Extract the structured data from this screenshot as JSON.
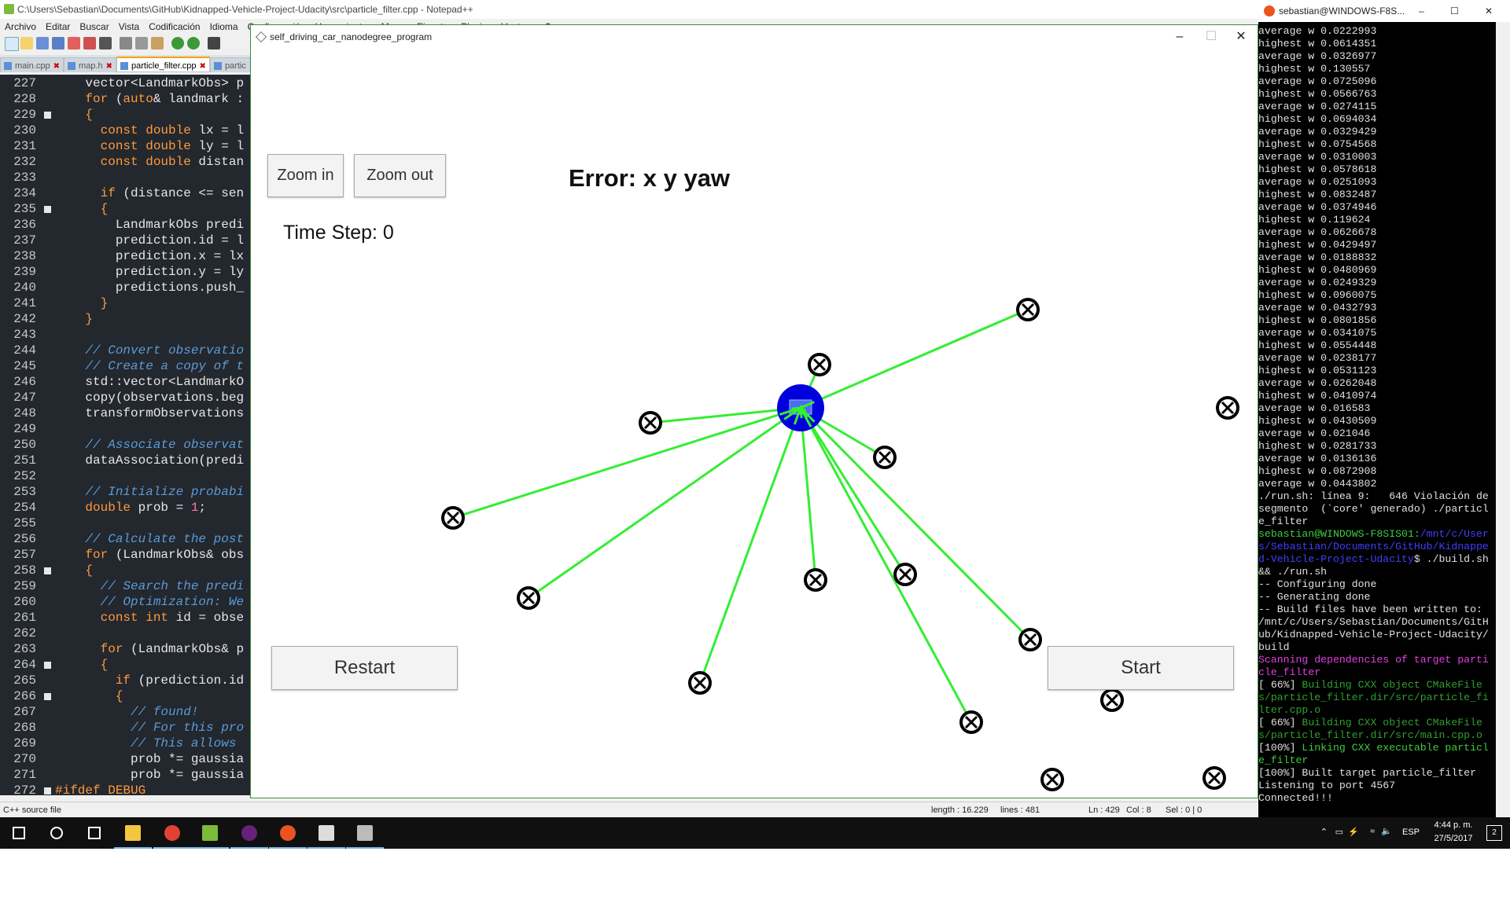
{
  "npp": {
    "title": "C:\\Users\\Sebastian\\Documents\\GitHub\\Kidnapped-Vehicle-Project-Udacity\\src\\particle_filter.cpp - Notepad++",
    "menu": [
      "Archivo",
      "Editar",
      "Buscar",
      "Vista",
      "Codificación",
      "Idioma",
      "Configuración",
      "Herramientas",
      "Macro",
      "Ejecutar",
      "Plugins",
      "Ventana",
      "?"
    ],
    "tabs": [
      {
        "label": "main.cpp",
        "active": false
      },
      {
        "label": "map.h",
        "active": false
      },
      {
        "label": "particle_filter.cpp",
        "active": true
      },
      {
        "label": "partic",
        "active": false
      }
    ],
    "code_lines": [
      {
        "n": "227",
        "fold": false,
        "segs": [
          {
            "t": "    vector<LandmarkObs> p",
            "c": ""
          }
        ]
      },
      {
        "n": "228",
        "fold": false,
        "segs": [
          {
            "t": "    ",
            "c": ""
          },
          {
            "t": "for",
            "c": "kw"
          },
          {
            "t": " (",
            "c": ""
          },
          {
            "t": "auto",
            "c": "kw"
          },
          {
            "t": "& landmark :",
            "c": ""
          }
        ]
      },
      {
        "n": "229",
        "fold": true,
        "segs": [
          {
            "t": "    {",
            "c": "kw"
          }
        ]
      },
      {
        "n": "230",
        "fold": false,
        "segs": [
          {
            "t": "      ",
            "c": ""
          },
          {
            "t": "const double",
            "c": "kw"
          },
          {
            "t": " lx = l",
            "c": ""
          }
        ]
      },
      {
        "n": "231",
        "fold": false,
        "segs": [
          {
            "t": "      ",
            "c": ""
          },
          {
            "t": "const double",
            "c": "kw"
          },
          {
            "t": " ly = l",
            "c": ""
          }
        ]
      },
      {
        "n": "232",
        "fold": false,
        "segs": [
          {
            "t": "      ",
            "c": ""
          },
          {
            "t": "const double",
            "c": "kw"
          },
          {
            "t": " distan",
            "c": ""
          }
        ]
      },
      {
        "n": "233",
        "fold": false,
        "segs": [
          {
            "t": "",
            "c": ""
          }
        ]
      },
      {
        "n": "234",
        "fold": false,
        "segs": [
          {
            "t": "      ",
            "c": ""
          },
          {
            "t": "if",
            "c": "kw"
          },
          {
            "t": " (distance <= sen",
            "c": ""
          }
        ]
      },
      {
        "n": "235",
        "fold": true,
        "segs": [
          {
            "t": "      {",
            "c": "kw"
          }
        ]
      },
      {
        "n": "236",
        "fold": false,
        "segs": [
          {
            "t": "        LandmarkObs predi",
            "c": ""
          }
        ]
      },
      {
        "n": "237",
        "fold": false,
        "segs": [
          {
            "t": "        prediction.id = l",
            "c": ""
          }
        ]
      },
      {
        "n": "238",
        "fold": false,
        "segs": [
          {
            "t": "        prediction.x = lx",
            "c": ""
          }
        ]
      },
      {
        "n": "239",
        "fold": false,
        "segs": [
          {
            "t": "        prediction.y = ly",
            "c": ""
          }
        ]
      },
      {
        "n": "240",
        "fold": false,
        "segs": [
          {
            "t": "        predictions.push_",
            "c": ""
          }
        ]
      },
      {
        "n": "241",
        "fold": false,
        "segs": [
          {
            "t": "      }",
            "c": "kw"
          }
        ]
      },
      {
        "n": "242",
        "fold": false,
        "segs": [
          {
            "t": "    }",
            "c": "kw"
          }
        ]
      },
      {
        "n": "243",
        "fold": false,
        "segs": [
          {
            "t": "",
            "c": ""
          }
        ]
      },
      {
        "n": "244",
        "fold": false,
        "segs": [
          {
            "t": "    // Convert observatio",
            "c": "cm"
          }
        ]
      },
      {
        "n": "245",
        "fold": false,
        "segs": [
          {
            "t": "    // Create a copy of t",
            "c": "cm"
          }
        ]
      },
      {
        "n": "246",
        "fold": false,
        "segs": [
          {
            "t": "    std::vector<LandmarkO",
            "c": ""
          }
        ]
      },
      {
        "n": "247",
        "fold": false,
        "segs": [
          {
            "t": "    copy(observations.beg",
            "c": ""
          }
        ]
      },
      {
        "n": "248",
        "fold": false,
        "segs": [
          {
            "t": "    transformObservations",
            "c": ""
          }
        ]
      },
      {
        "n": "249",
        "fold": false,
        "segs": [
          {
            "t": "",
            "c": ""
          }
        ]
      },
      {
        "n": "250",
        "fold": false,
        "segs": [
          {
            "t": "    // Associate observat",
            "c": "cm"
          }
        ]
      },
      {
        "n": "251",
        "fold": false,
        "segs": [
          {
            "t": "    dataAssociation(predi",
            "c": ""
          }
        ]
      },
      {
        "n": "252",
        "fold": false,
        "segs": [
          {
            "t": "",
            "c": ""
          }
        ]
      },
      {
        "n": "253",
        "fold": false,
        "segs": [
          {
            "t": "    // Initialize probabi",
            "c": "cm"
          }
        ]
      },
      {
        "n": "254",
        "fold": false,
        "segs": [
          {
            "t": "    ",
            "c": ""
          },
          {
            "t": "double",
            "c": "kw"
          },
          {
            "t": " prob = ",
            "c": ""
          },
          {
            "t": "1",
            "c": "num"
          },
          {
            "t": ";",
            "c": ""
          }
        ]
      },
      {
        "n": "255",
        "fold": false,
        "segs": [
          {
            "t": "",
            "c": ""
          }
        ]
      },
      {
        "n": "256",
        "fold": false,
        "segs": [
          {
            "t": "    // Calculate the post",
            "c": "cm"
          }
        ]
      },
      {
        "n": "257",
        "fold": false,
        "segs": [
          {
            "t": "    ",
            "c": ""
          },
          {
            "t": "for",
            "c": "kw"
          },
          {
            "t": " (LandmarkObs& obs",
            "c": ""
          }
        ]
      },
      {
        "n": "258",
        "fold": true,
        "segs": [
          {
            "t": "    {",
            "c": "kw"
          }
        ]
      },
      {
        "n": "259",
        "fold": false,
        "segs": [
          {
            "t": "      // Search the predi",
            "c": "cm"
          }
        ]
      },
      {
        "n": "260",
        "fold": false,
        "segs": [
          {
            "t": "      // Optimization: We",
            "c": "cm"
          }
        ]
      },
      {
        "n": "261",
        "fold": false,
        "segs": [
          {
            "t": "      ",
            "c": ""
          },
          {
            "t": "const int",
            "c": "kw"
          },
          {
            "t": " id = obse",
            "c": ""
          }
        ]
      },
      {
        "n": "262",
        "fold": false,
        "segs": [
          {
            "t": "",
            "c": ""
          }
        ]
      },
      {
        "n": "263",
        "fold": false,
        "segs": [
          {
            "t": "      ",
            "c": ""
          },
          {
            "t": "for",
            "c": "kw"
          },
          {
            "t": " (LandmarkObs& p",
            "c": ""
          }
        ]
      },
      {
        "n": "264",
        "fold": true,
        "segs": [
          {
            "t": "      {",
            "c": "kw"
          }
        ]
      },
      {
        "n": "265",
        "fold": false,
        "segs": [
          {
            "t": "        ",
            "c": ""
          },
          {
            "t": "if",
            "c": "kw"
          },
          {
            "t": " (prediction.id",
            "c": ""
          }
        ]
      },
      {
        "n": "266",
        "fold": true,
        "segs": [
          {
            "t": "        {",
            "c": "kw"
          }
        ]
      },
      {
        "n": "267",
        "fold": false,
        "segs": [
          {
            "t": "          // found!",
            "c": "cm"
          }
        ]
      },
      {
        "n": "268",
        "fold": false,
        "segs": [
          {
            "t": "          // For this pro",
            "c": "cm"
          }
        ]
      },
      {
        "n": "269",
        "fold": false,
        "segs": [
          {
            "t": "          // This allows ",
            "c": "cm"
          }
        ]
      },
      {
        "n": "270",
        "fold": false,
        "segs": [
          {
            "t": "          prob *= gaussia",
            "c": ""
          }
        ]
      },
      {
        "n": "271",
        "fold": false,
        "segs": [
          {
            "t": "          prob *= gaussia",
            "c": ""
          }
        ]
      },
      {
        "n": "272",
        "fold": true,
        "segs": [
          {
            "t": "#ifdef DEBUG",
            "c": "kw"
          }
        ]
      }
    ],
    "status": {
      "file_type": "C++ source file",
      "length": "length : 16.229",
      "lines": "lines : 481",
      "ln": "Ln : 429",
      "col": "Col : 8",
      "sel": "Sel : 0 | 0"
    }
  },
  "sim": {
    "title": "self_driving_car_nanodegree_program",
    "zoom_in": "Zoom in",
    "zoom_out": "Zoom out",
    "error": "Error: x y yaw",
    "time_step": "Time Step: 0",
    "restart": "Restart",
    "start": "Start"
  },
  "terminal": {
    "title": "sebastian@WINDOWS-F8S...",
    "lines": [
      {
        "t": "average w 0.0222993",
        "c": ""
      },
      {
        "t": "highest w 0.0614351",
        "c": ""
      },
      {
        "t": "average w 0.0326977",
        "c": ""
      },
      {
        "t": "highest w 0.130557",
        "c": ""
      },
      {
        "t": "average w 0.0725096",
        "c": ""
      },
      {
        "t": "highest w 0.0566763",
        "c": ""
      },
      {
        "t": "average w 0.0274115",
        "c": ""
      },
      {
        "t": "highest w 0.0694034",
        "c": ""
      },
      {
        "t": "average w 0.0329429",
        "c": ""
      },
      {
        "t": "highest w 0.0754568",
        "c": ""
      },
      {
        "t": "average w 0.0310003",
        "c": ""
      },
      {
        "t": "highest w 0.0578618",
        "c": ""
      },
      {
        "t": "average w 0.0251093",
        "c": ""
      },
      {
        "t": "highest w 0.0832487",
        "c": ""
      },
      {
        "t": "average w 0.0374946",
        "c": ""
      },
      {
        "t": "highest w 0.119624",
        "c": ""
      },
      {
        "t": "average w 0.0626678",
        "c": ""
      },
      {
        "t": "highest w 0.0429497",
        "c": ""
      },
      {
        "t": "average w 0.0188832",
        "c": ""
      },
      {
        "t": "highest w 0.0480969",
        "c": ""
      },
      {
        "t": "average w 0.0249329",
        "c": ""
      },
      {
        "t": "highest w 0.0960075",
        "c": ""
      },
      {
        "t": "average w 0.0432793",
        "c": ""
      },
      {
        "t": "highest w 0.0801856",
        "c": ""
      },
      {
        "t": "average w 0.0341075",
        "c": ""
      },
      {
        "t": "highest w 0.0554448",
        "c": ""
      },
      {
        "t": "average w 0.0238177",
        "c": ""
      },
      {
        "t": "highest w 0.0531123",
        "c": ""
      },
      {
        "t": "average w 0.0262048",
        "c": ""
      },
      {
        "t": "highest w 0.0410974",
        "c": ""
      },
      {
        "t": "average w 0.016583",
        "c": ""
      },
      {
        "t": "highest w 0.0430509",
        "c": ""
      },
      {
        "t": "average w 0.021046",
        "c": ""
      },
      {
        "t": "highest w 0.0281733",
        "c": ""
      },
      {
        "t": "average w 0.0136136",
        "c": ""
      },
      {
        "t": "highest w 0.0872908",
        "c": ""
      },
      {
        "t": "average w 0.0443802",
        "c": ""
      },
      {
        "t": "./run.sh: línea 9:   646 Violación de segmento  (`core' generado) ./particle_filter",
        "c": ""
      },
      {
        "t": "sebastian@WINDOWS-F8SIS01:",
        "c": "tg",
        "x": [
          {
            "t": "/mnt/c/Users/Sebastian/Documents/GitHub/Kidnapped-Vehicle-Project-Udacity",
            "c": "tbl"
          },
          {
            "t": "$ ./build.sh && ./run.sh",
            "c": ""
          }
        ]
      },
      {
        "t": "-- Configuring done",
        "c": ""
      },
      {
        "t": "-- Generating done",
        "c": ""
      },
      {
        "t": "-- Build files have been written to: /mnt/c/Users/Sebastian/Documents/GitHub/Kidnapped-Vehicle-Project-Udacity/build",
        "c": ""
      },
      {
        "t": "Scanning dependencies of target particle_filter",
        "c": "tm"
      },
      {
        "t": "[ 66%] ",
        "c": "",
        "x": [
          {
            "t": "Building CXX object CMakeFiles/particle_filter.dir/src/particle_filter.cpp.o",
            "c": "tdg"
          }
        ]
      },
      {
        "t": "[ 66%] ",
        "c": "",
        "x": [
          {
            "t": "Building CXX object CMakeFiles/particle_filter.dir/src/main.cpp.o",
            "c": "tdg"
          }
        ]
      },
      {
        "t": "[100%] ",
        "c": "",
        "x": [
          {
            "t": "Linking CXX executable particle_filter",
            "c": "tg"
          }
        ]
      },
      {
        "t": "[100%] Built target particle_filter",
        "c": ""
      },
      {
        "t": "Listening to port 4567",
        "c": ""
      },
      {
        "t": "Connected!!!",
        "c": ""
      }
    ]
  },
  "taskbar": {
    "icons": [
      "windows-start-icon",
      "search-icon",
      "task-view-icon",
      "file-explorer-icon",
      "chrome-icon",
      "notepad-plus-plus-icon",
      "visual-studio-icon",
      "ubuntu-icon",
      "unity-icon",
      "simulator-icon"
    ],
    "lang": "ESP",
    "time": "4:44 p. m.",
    "date": "27/5/2017",
    "notifications": "2"
  },
  "colors": {
    "observation_line": "#33ee33",
    "vehicle": "#0000dd",
    "landmark_stroke": "#000000"
  }
}
